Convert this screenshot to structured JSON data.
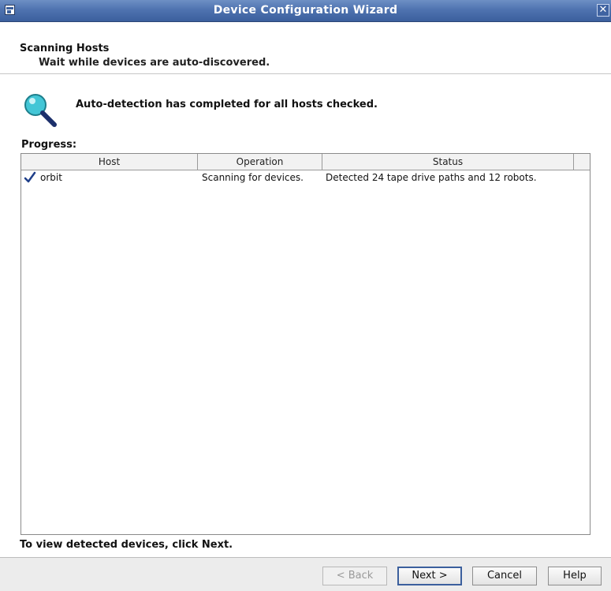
{
  "window": {
    "title": "Device Configuration Wizard",
    "close_glyph": "✕"
  },
  "header": {
    "title": "Scanning Hosts",
    "subtitle": "Wait while devices are auto-discovered."
  },
  "main": {
    "icon": "magnifier-icon",
    "message": "Auto-detection has completed for all hosts checked.",
    "progress_label": "Progress:",
    "table": {
      "columns": [
        "Host",
        "Operation",
        "Status"
      ],
      "rows": [
        {
          "status_icon": "check-icon",
          "host": "orbit",
          "operation": "Scanning for devices.",
          "status": "Detected 24 tape drive paths and 12 robots."
        }
      ]
    },
    "footer_note": "To view detected devices, click Next."
  },
  "buttons": {
    "back": "< Back",
    "next": "Next >",
    "cancel": "Cancel",
    "help": "Help"
  },
  "colors": {
    "titlebar": "#4f73b0",
    "check": "#1f3f8a",
    "lens": "#43c6d6"
  }
}
